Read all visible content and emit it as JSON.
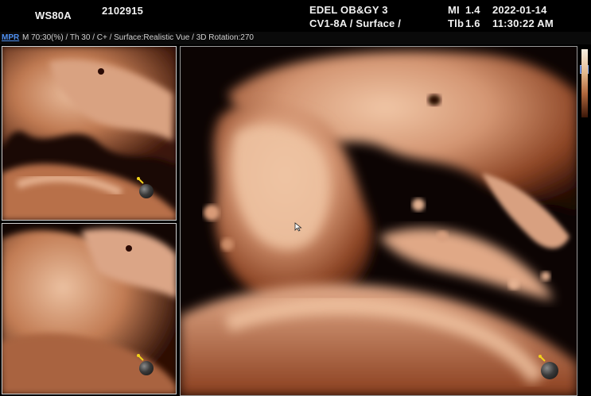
{
  "header": {
    "model": "WS80A",
    "patient_id": "2102915",
    "institution": "EDEL OB&GY 3",
    "probe_preset": "CV1-8A / Surface /",
    "mi_label": "MI",
    "mi_value": "1.4",
    "tib_label": "Tlb",
    "tib_value": "1.6",
    "date": "2022-01-14",
    "time": "11:30:22 AM"
  },
  "infobar": {
    "mode": "MPR",
    "params": "M 70:30(%) / Th 30 / C+ / Surface:Realistic Vue / 3D Rotation:270"
  },
  "colors": {
    "mode_tag": "#4f8ff0",
    "tissue_light": "#e8b796",
    "tissue_mid": "#b8704a",
    "tissue_dark": "#4a1c0c",
    "marker_pin": "#f2d21a"
  },
  "icons": {
    "corner_button": "layout-icon",
    "marker": "orientation-ball-icon",
    "cursor": "mouse-pointer-icon"
  }
}
